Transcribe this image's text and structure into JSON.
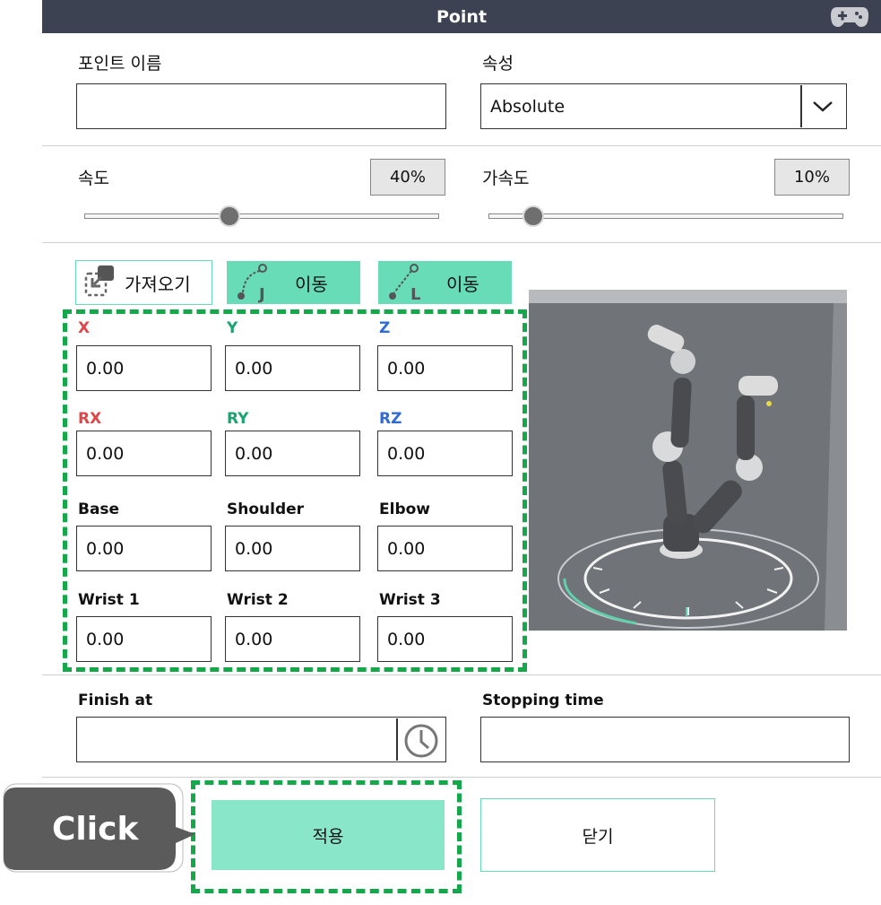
{
  "header": {
    "title": "Point",
    "icon": "gamepad-icon"
  },
  "point_name": {
    "label": "포인트 이름",
    "value": ""
  },
  "attribute": {
    "label": "속성",
    "value": "Absolute"
  },
  "speed": {
    "label": "속도",
    "value_text": "40%",
    "level": 0.4
  },
  "accel": {
    "label": "가속도",
    "value_text": "10%",
    "level": 0.1
  },
  "actions": {
    "import_label": "가져오기",
    "move_j_label": "이동",
    "move_l_label": "이동",
    "move_j_tag": "J",
    "move_l_tag": "L"
  },
  "coords": {
    "x": {
      "label": "X",
      "value": "0.00",
      "color": "#e0454a"
    },
    "y": {
      "label": "Y",
      "value": "0.00",
      "color": "#1aa56e"
    },
    "z": {
      "label": "Z",
      "value": "0.00",
      "color": "#2e6bd6"
    },
    "rx": {
      "label": "RX",
      "value": "0.00",
      "color": "#e0454a"
    },
    "ry": {
      "label": "RY",
      "value": "0.00",
      "color": "#1aa56e"
    },
    "rz": {
      "label": "RZ",
      "value": "0.00",
      "color": "#2e6bd6"
    },
    "base": {
      "label": "Base",
      "value": "0.00"
    },
    "shoulder": {
      "label": "Shoulder",
      "value": "0.00"
    },
    "elbow": {
      "label": "Elbow",
      "value": "0.00"
    },
    "wrist1": {
      "label": "Wrist 1",
      "value": "0.00"
    },
    "wrist2": {
      "label": "Wrist 2",
      "value": "0.00"
    },
    "wrist3": {
      "label": "Wrist 3",
      "value": "0.00"
    }
  },
  "finish_at": {
    "label": "Finish at",
    "value": ""
  },
  "stopping_time": {
    "label": "Stopping time",
    "value": ""
  },
  "footer": {
    "apply_label": "적용",
    "close_label": "닫기"
  },
  "callout": {
    "text": "Click"
  }
}
